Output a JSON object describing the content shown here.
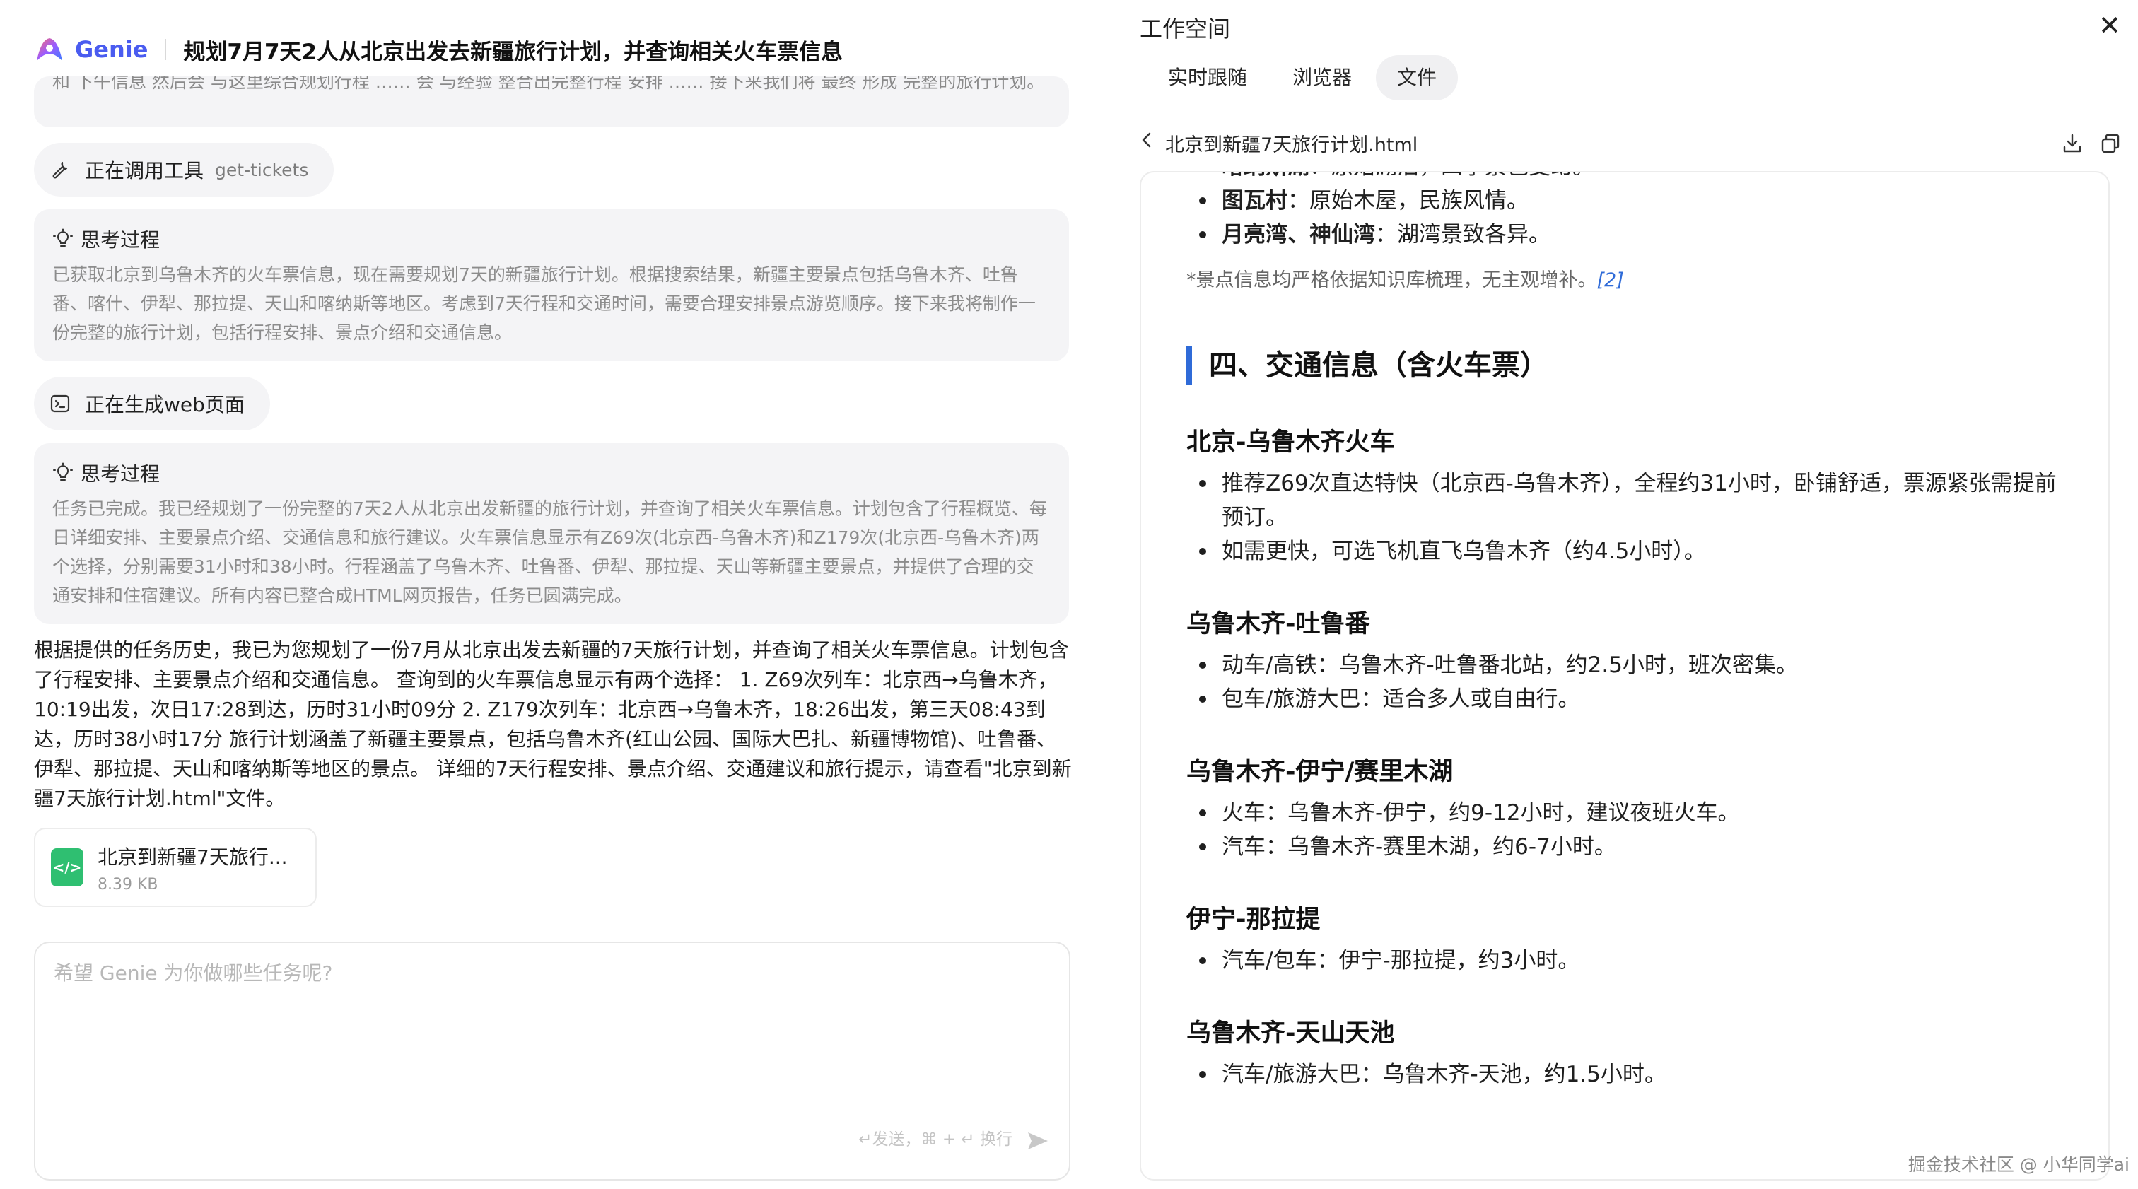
{
  "app": {
    "logo_text": "Genie",
    "title": "规划7月7天2人从北京出发去新疆旅行计划，并查询相关火车票信息"
  },
  "chat": {
    "clipped_text": "和 下午信息 然后会 与这里综合规划行程 …… 会 与经验 整合出完整行程 安排 …… 接下来我们将 最终 形成 完整的旅行计划。",
    "clipped_tail": "整的旅行计划。",
    "tool_call": {
      "label": "正在调用工具",
      "tool": "get-tickets",
      "icon": "tool-icon"
    },
    "think1": {
      "heading": "思考过程",
      "body": "已获取北京到乌鲁木齐的火车票信息，现在需要规划7天的新疆旅行计划。根据搜索结果，新疆主要景点包括乌鲁木齐、吐鲁番、喀什、伊犁、那拉提、天山和喀纳斯等地区。考虑到7天行程和交通时间，需要合理安排景点游览顺序。接下来我将制作一份完整的旅行计划，包括行程安排、景点介绍和交通信息。"
    },
    "web_gen": {
      "label": "正在生成web页面",
      "icon": "terminal-icon"
    },
    "think2": {
      "heading": "思考过程",
      "body": "任务已完成。我已经规划了一份完整的7天2人从北京出发新疆的旅行计划，并查询了相关火车票信息。计划包含了行程概览、每日详细安排、主要景点介绍、交通信息和旅行建议。火车票信息显示有Z69次(北京西-乌鲁木齐)和Z179次(北京西-乌鲁木齐)两个选择，分别需要31小时和38小时。行程涵盖了乌鲁木齐、吐鲁番、伊犁、那拉提、天山等新疆主要景点，并提供了合理的交通安排和住宿建议。所有内容已整合成HTML网页报告，任务已圆满完成。"
    },
    "answer": "根据提供的任务历史，我已为您规划了一份7月从北京出发去新疆的7天旅行计划，并查询了相关火车票信息。计划包含了行程安排、主要景点介绍和交通信息。 查询到的火车票信息显示有两个选择： 1. Z69次列车：北京西→乌鲁木齐，10:19出发，次日17:28到达，历时31小时09分 2. Z179次列车：北京西→乌鲁木齐，18:26出发，第三天08:43到达，历时38小时17分 旅行计划涵盖了新疆主要景点，包括乌鲁木齐(红山公园、国际大巴扎、新疆博物馆)、吐鲁番、伊犁、那拉提、天山和喀纳斯等地区的景点。 详细的7天行程安排、景点介绍、交通建议和旅行提示，请查看\"北京到新疆7天旅行计划.html\"文件。",
    "file": {
      "name": "北京到新疆7天旅行...",
      "size": "8.39 KB",
      "icon": "code-file-icon"
    }
  },
  "composer": {
    "placeholder": "希望 Genie 为你做哪些任务呢?",
    "hint": "↵发送，⌘ + ↵ 换行",
    "send_icon": "send-icon"
  },
  "workspace": {
    "title": "工作空间",
    "close_icon": "close-icon",
    "tabs": [
      {
        "label": "实时跟随"
      },
      {
        "label": "浏览器"
      },
      {
        "label": "文件"
      }
    ],
    "active_tab": "文件",
    "file_path": "北京到新疆7天旅行计划.html",
    "download_icon": "download-icon",
    "copy_icon": "copy-icon"
  },
  "doc": {
    "cut_item": {
      "bold": "喀纳斯湖",
      "text": "：原始湖泊，四季景色变幻。"
    },
    "items_top": [
      {
        "bold": "图瓦村",
        "text": "：原始木屋，民族风情。"
      },
      {
        "bold": "月亮湾、神仙湾",
        "text": "：湖湾景致各异。"
      }
    ],
    "note": "*景点信息均严格依据知识库梳理，无主观增补。",
    "note_ref": "[2]",
    "section_title": "四、交通信息（含火车票）",
    "routes": [
      {
        "title": "北京-乌鲁木齐火车",
        "items": [
          "推荐Z69次直达特快（北京西-乌鲁木齐），全程约31小时，卧铺舒适，票源紧张需提前预订。",
          "如需更快，可选飞机直飞乌鲁木齐（约4.5小时）。"
        ]
      },
      {
        "title": "乌鲁木齐-吐鲁番",
        "items": [
          "动车/高铁：乌鲁木齐-吐鲁番北站，约2.5小时，班次密集。",
          "包车/旅游大巴：适合多人或自由行。"
        ]
      },
      {
        "title": "乌鲁木齐-伊宁/赛里木湖",
        "items": [
          "火车：乌鲁木齐-伊宁，约9-12小时，建议夜班火车。",
          "汽车：乌鲁木齐-赛里木湖，约6-7小时。"
        ]
      },
      {
        "title": "伊宁-那拉提",
        "items": [
          "汽车/包车：伊宁-那拉提，约3小时。"
        ]
      },
      {
        "title": "乌鲁木齐-天山天池",
        "items": [
          "汽车/旅游大巴：乌鲁木齐-天池，约1.5小时。"
        ]
      }
    ]
  },
  "watermark": "掘金技术社区 @ 小华同学ai",
  "colors": {
    "brand": "#4a5cf0",
    "accent": "#2f6bd8",
    "file_green": "#2fbf71"
  }
}
